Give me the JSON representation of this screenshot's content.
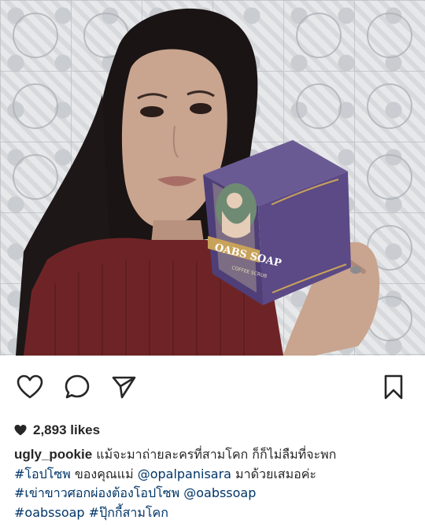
{
  "post": {
    "image_alt": "Woman holding a purple OABS SOAP coffee soap box",
    "product": {
      "brand": "OABS SOAP",
      "variant": "COFFEE SCRUB"
    }
  },
  "actions": {
    "like_icon": "heart-outline-icon",
    "comment_icon": "comment-bubble-icon",
    "share_icon": "paper-plane-icon",
    "save_icon": "bookmark-icon"
  },
  "likes": {
    "icon": "heart-filled-icon",
    "text": "2,893 likes"
  },
  "caption": {
    "username": "ugly_pookie",
    "line1_text": " แม้จะมาถ่ายละครที่สามโคก ก็ก็ไม่ลืมที่จะพก",
    "line2_tag": "#โอปโซพ",
    "line2_text": " ของคุณแม่ ",
    "line2_mention": "@opalpanisara",
    "line2_text2": " มาด้วยเสมอค่ะ",
    "line3_tag": "#เข่าขาวศอกผ่องต้องโอปโซพ",
    "line3_mention": "@oabssoap",
    "line4_tag1": "#oabssoap",
    "line4_tag2": "#ปุ๊กกี้สามโคก"
  },
  "colors": {
    "link": "#003569",
    "text": "#262626",
    "box_purple": "#5b4a86",
    "box_gold": "#c8a25a"
  }
}
